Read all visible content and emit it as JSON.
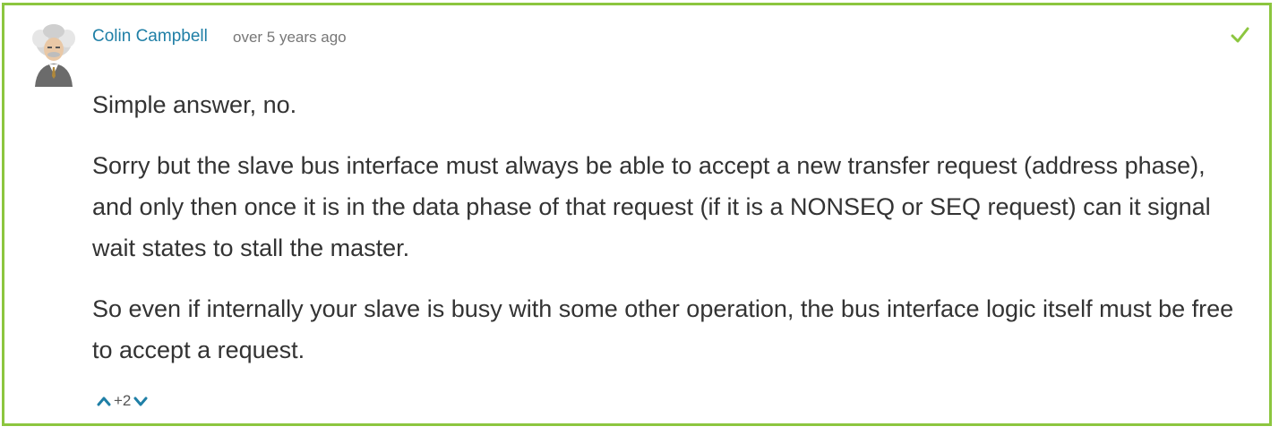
{
  "answer": {
    "author": "Colin Campbell",
    "timestamp": "over 5 years ago",
    "accepted": true,
    "paragraphs": [
      "Simple answer, no.",
      "Sorry but the slave bus interface must always be able to accept a new transfer request (address phase), and only then once it is in the data phase of that request (if it is a NONSEQ or SEQ request) can it signal wait states to stall the master.",
      "So even if internally your slave is busy with some other operation, the bus interface logic itself must be free to accept a request."
    ],
    "votes": "+2"
  },
  "icons": {
    "avatar": "avatar-einstein-icon",
    "accepted": "check-icon",
    "upvote": "chevron-up-icon",
    "downvote": "chevron-down-icon"
  },
  "colors": {
    "accent_border": "#8cc63f",
    "author_link": "#1f7fa6",
    "check": "#8cc63f",
    "vote_chevron": "#1f7fa6",
    "body_text": "#333333"
  }
}
